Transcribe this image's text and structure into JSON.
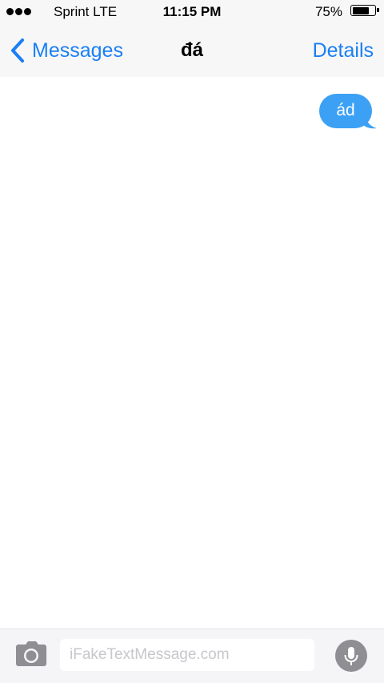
{
  "status_bar": {
    "carrier": "Sprint  LTE",
    "time": "11:15 PM",
    "battery_percent": "75%",
    "battery_level": 0.75,
    "signal_dots": 3
  },
  "nav": {
    "back_label": "Messages",
    "title": "đá",
    "details_label": "Details",
    "accent_color": "#1a7ff5"
  },
  "messages": [
    {
      "direction": "outgoing",
      "text": "ád",
      "color": "#3ca1f5"
    }
  ],
  "input": {
    "placeholder": "iFakeTextMessage.com",
    "camera_icon": "camera-icon",
    "mic_icon": "microphone-icon"
  }
}
